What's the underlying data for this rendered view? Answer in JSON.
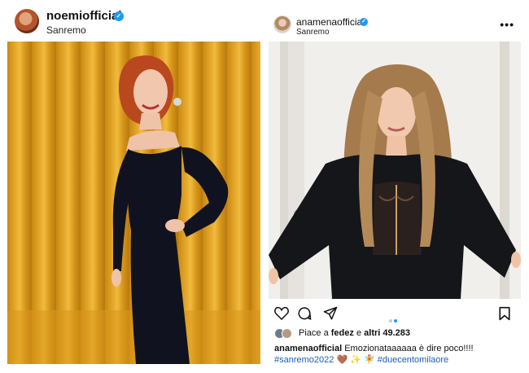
{
  "posts": [
    {
      "username": "noemiofficial",
      "location": "Sanremo",
      "verified": true
    },
    {
      "username": "anamenaofficial",
      "location": "Sanremo",
      "verified": true,
      "more_icon": "•••",
      "actions": {
        "like_icon": "heart-icon",
        "comment_icon": "comment-icon",
        "share_icon": "share-icon",
        "save_icon": "bookmark-icon"
      },
      "carousel": {
        "count": 2,
        "active": 2
      },
      "likes": {
        "prefix": "Piace a",
        "user": "fedez",
        "joiner": "e",
        "others": "altri 49.283"
      },
      "caption": {
        "user": "anamenaofficial",
        "text": "Emozionataaaaaa è dire poco!!!!"
      },
      "hashtag_1": "#sanremo2022",
      "hashtag_emoji": "🤎 ✨ 🧚",
      "hashtag_2": "#duecentomilaore"
    }
  ],
  "colors": {
    "verified": "#1d9bf0",
    "hashtag": "#1c5fb4",
    "curtain": "#e3a52a",
    "dot_active": "#1d9bf0",
    "dot_inactive": "#c8c8c8"
  }
}
